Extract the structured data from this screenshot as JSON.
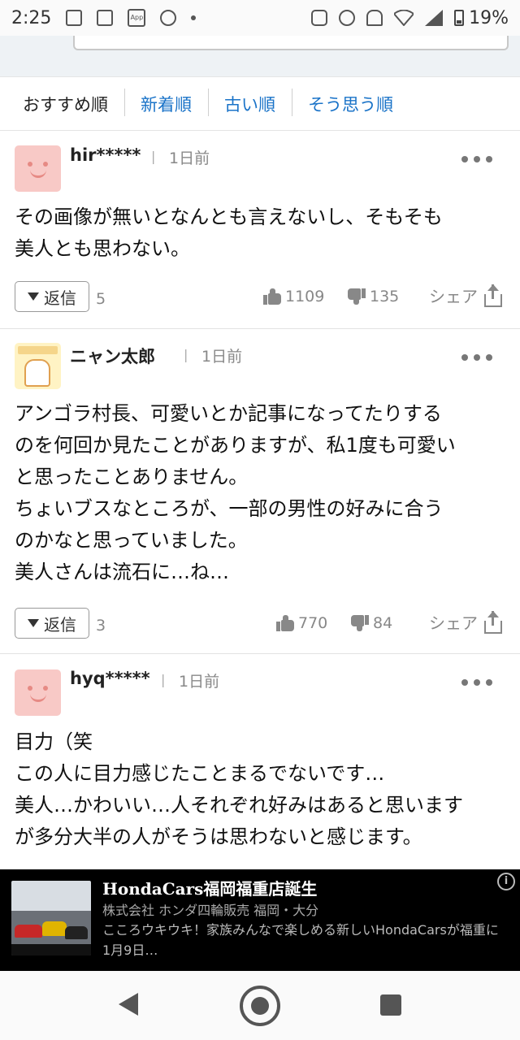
{
  "status_bar": {
    "time": "2:25",
    "battery": "19%",
    "app_badge": "App"
  },
  "sort_tabs": [
    {
      "label": "おすすめ順",
      "active": true
    },
    {
      "label": "新着順",
      "active": false
    },
    {
      "label": "古い順",
      "active": false
    },
    {
      "label": "そう思う順",
      "active": false
    }
  ],
  "comments": [
    {
      "user": "hir*****",
      "time": "1日前",
      "body": "その画像が無いとなんとも言えないし、そもそも\n美人とも思わない。",
      "reply_label": "返信",
      "reply_count": "5",
      "likes": "1109",
      "dislikes": "135",
      "share_label": "シェア"
    },
    {
      "user": "ニャン太郎",
      "time": "1日前",
      "body": "アンゴラ村長、可愛いとか記事になってたりする\nのを何回か見たことがありますが、私1度も可愛い\nと思ったことありません。\nちょいブスなところが、一部の男性の好みに合う\nのかなと思っていました。\n美人さんは流石に…ね…",
      "reply_label": "返信",
      "reply_count": "3",
      "likes": "770",
      "dislikes": "84",
      "share_label": "シェア"
    },
    {
      "user": "hyq*****",
      "time": "1日前",
      "body": "目力（笑\nこの人に目力感じたことまるでないです…\n美人…かわいい…人それぞれ好みはあると思います\nが多分大半の人がそうは思わないと感じます。"
    }
  ],
  "ad": {
    "title": "HondaCars福岡福重店誕生",
    "sponsor": "株式会社 ホンダ四輪販売 福岡・大分",
    "description": "こころウキウキ！家族みんなで楽しめる新しいHondaCarsが福重に1月9日…",
    "info_icon": "i"
  }
}
